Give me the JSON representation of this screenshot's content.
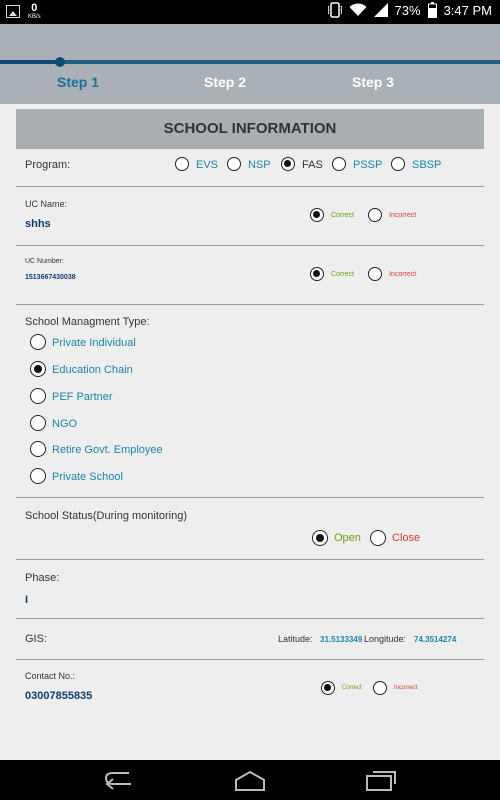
{
  "status_bar": {
    "network_speed": "0",
    "network_unit": "KB/s",
    "battery": "73%",
    "time": "3:47 PM",
    "icons": [
      "image-icon",
      "vibrate-icon",
      "wifi-icon",
      "signal-icon",
      "battery-icon"
    ]
  },
  "stepper": {
    "steps": [
      "Step 1",
      "Step 2",
      "Step 3"
    ],
    "active_step": 0,
    "progress": 0.12
  },
  "form": {
    "title": "SCHOOL INFORMATION",
    "program": {
      "label": "Program:",
      "options": [
        "EVS",
        "NSP",
        "FAS",
        "PSSP",
        "SBSP"
      ],
      "selected": "FAS"
    },
    "uc_name": {
      "label": "UC Name:",
      "value": "shhs",
      "check_options": [
        "Correct",
        "Incorrect"
      ],
      "selected": "Correct"
    },
    "uc_number": {
      "label": "UC Number:",
      "value": "1513667430038",
      "check_options": [
        "Correct",
        "Incorrect"
      ],
      "selected": "Correct"
    },
    "management_type": {
      "label": "School Managment Type:",
      "options": [
        "Private Individual",
        "Education Chain",
        "PEF Partner",
        "NGO",
        "Retire Govt. Employee",
        "Private School"
      ],
      "selected": "Education Chain"
    },
    "school_status": {
      "label": "School Status(During monitoring)",
      "options": [
        "Open",
        "Close"
      ],
      "selected": "Open"
    },
    "phase": {
      "label": "Phase:",
      "value": "I"
    },
    "gis": {
      "label": "GIS:",
      "latitude_label": "Latitude:",
      "latitude": "31.5133349",
      "longitude_label": "Longitude:",
      "longitude": "74.3514274"
    },
    "contact": {
      "label": "Contact No.:",
      "value": "03007855835",
      "check_options": [
        "Correct",
        "Incorrect"
      ],
      "selected": "Correct"
    }
  },
  "colors": {
    "accent": "#1a86a6",
    "correct": "#6a9f0e",
    "incorrect": "#d13c3c",
    "header_bg": "#aab1b6",
    "progress": "#0b4c74"
  }
}
